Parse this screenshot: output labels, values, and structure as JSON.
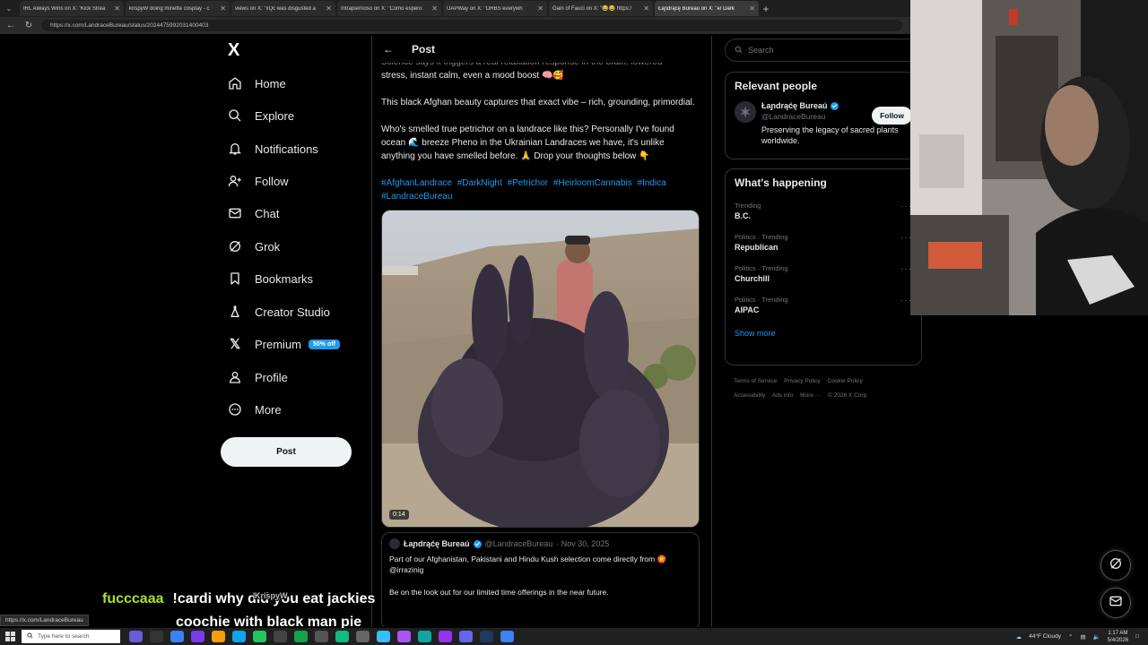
{
  "browser": {
    "tabs": [
      {
        "label": "IRL Always Wins on X: \"Kick Strea"
      },
      {
        "label": "krispyW doing minette cosplay - c"
      },
      {
        "label": "views on X: \"xQc was disgusted a"
      },
      {
        "label": "Intrapiernoso on X: \"Como espero"
      },
      {
        "label": "UAPWay on X: \"ORBS everywh"
      },
      {
        "label": "Gain of Fauci on X: \"😂😂 https:/"
      },
      {
        "label": "Łaɲdrąćę Bureaú on X: \"ᴀr Dark"
      }
    ],
    "url": "https://x.com/LandraceBureau/status/2024475992031400403"
  },
  "nav": {
    "logo": "X",
    "items": [
      {
        "label": "Home",
        "icon": "home-icon"
      },
      {
        "label": "Explore",
        "icon": "search-icon"
      },
      {
        "label": "Notifications",
        "icon": "bell-icon"
      },
      {
        "label": "Follow",
        "icon": "person-plus-icon"
      },
      {
        "label": "Chat",
        "icon": "mail-icon"
      },
      {
        "label": "Grok",
        "icon": "grok-icon"
      },
      {
        "label": "Bookmarks",
        "icon": "bookmark-icon"
      },
      {
        "label": "Creator Studio",
        "icon": "flask-icon"
      },
      {
        "label": "Premium",
        "icon": "x-icon"
      },
      {
        "label": "Profile",
        "icon": "person-icon"
      },
      {
        "label": "More",
        "icon": "more-circle-icon"
      }
    ],
    "premium_badge": "50% off",
    "post_button": "Post"
  },
  "post": {
    "header_title": "Post",
    "text_line0": "Science says it triggers a real relaxation response in the brain: lowered",
    "text_line1": "stress, instant calm, even a mood boost 🧠🥰",
    "text_para2": "This black Afghan beauty captures that exact vibe – rich, grounding, primordial.",
    "text_para3": "Who's smelled true petrichor on a landrace like this? Personally I've found ocean 🌊 breeze Pheno in the Ukrainian Landraces we have, it's unlike anything you have smelled before. 🙏 Drop your thoughts below 👇",
    "hashtags": [
      "#AfghanLandrace",
      "#DarkNight",
      "#Petrichor",
      "#HeirloomCannabis",
      "#Indica",
      "#LandraceBureau"
    ],
    "video_duration": "0:14",
    "quote": {
      "name": "Łaɲdrąćę Bureaú",
      "handle": "@LandraceBureau",
      "date": "· Nov 30, 2025",
      "text1": "Part of our Afghanistan, Pakistani and Hindu Kush selection come directly from 🏵️ @irrazinig",
      "text2": "Be on the look out for our limited time offerings in the near future."
    }
  },
  "sidebar": {
    "search_placeholder": "Search",
    "relevant_title": "Relevant people",
    "person": {
      "name": "Łaɲdrąćę Bureaú",
      "handle": "@LandraceBureau",
      "bio": "Preserving the legacy of sacred plants worldwide.",
      "follow": "Follow"
    },
    "happening_title": "What's happening",
    "trends": [
      {
        "meta": "Trending",
        "name": "B.C."
      },
      {
        "meta": "Politics · Trending",
        "name": "Republican"
      },
      {
        "meta": "Politics · Trending",
        "name": "Churchill"
      },
      {
        "meta": "Politics · Trending",
        "name": "AIPAC"
      }
    ],
    "show_more": "Show more",
    "footer": [
      "Terms of Service",
      "Privacy Policy",
      "Cookie Policy",
      "Accessibility",
      "Ads info",
      "More ···",
      "© 2026 X Corp."
    ]
  },
  "overlay": {
    "chat_user": "fucccaaa",
    "chat_msg_line1": "!cardi why did you eat jackies",
    "chat_msg_line2": "coochie with black man pie",
    "chat_ghost": "KrispyW",
    "status_url": "https://x.com/LandraceBureau"
  },
  "taskbar": {
    "search_placeholder": "Type here to search",
    "weather": "44°F Cloudy",
    "time": "1:17 AM",
    "date": "5/4/2026"
  },
  "colors": {
    "accent": "#1d9bf0",
    "background": "#000000",
    "border": "#2f3336"
  }
}
